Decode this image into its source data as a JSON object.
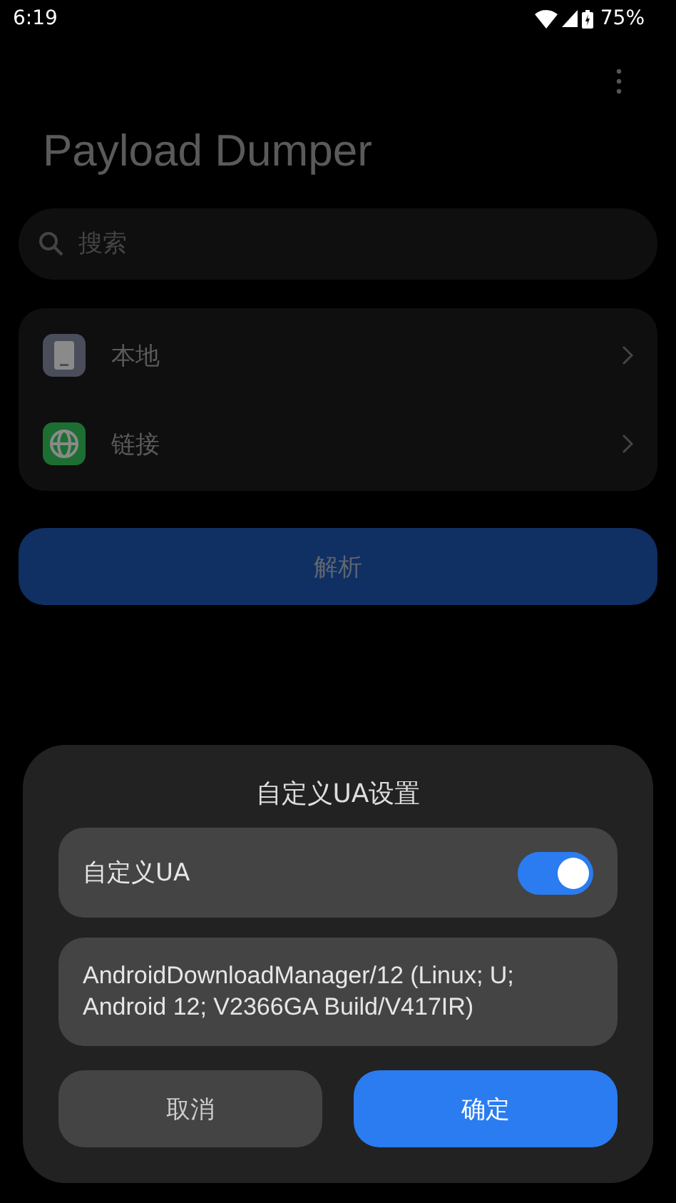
{
  "status_bar": {
    "time": "6:19",
    "battery": "75%"
  },
  "app_bar": {
    "title": "Payload Dumper"
  },
  "search": {
    "placeholder": "搜索"
  },
  "sources": [
    {
      "label": "本地",
      "kind": "device"
    },
    {
      "label": "链接",
      "kind": "globe"
    }
  ],
  "parse_button": "解析",
  "dialog": {
    "title": "自定义UA设置",
    "switch": {
      "label": "自定义UA",
      "on": true
    },
    "ua_field": {
      "value": "AndroidDownloadManager/12 (Linux; U; Android 12; V2366GA Build/V417IR)"
    },
    "buttons": [
      {
        "label": "取消",
        "kind": "secondary"
      },
      {
        "label": "确定",
        "kind": "primary"
      }
    ]
  }
}
